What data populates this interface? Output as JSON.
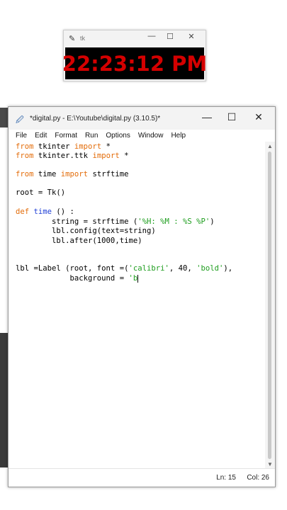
{
  "clock_window": {
    "title": "tk",
    "time": "22:23:12 PM",
    "controls": {
      "minimize": "—",
      "maximize": "☐",
      "close": "✕"
    }
  },
  "editor": {
    "title": "*digital.py - E:\\Youtube\\digital.py (3.10.5)*",
    "controls": {
      "minimize": "—",
      "maximize": "☐",
      "close": "✕"
    },
    "menu": [
      "File",
      "Edit",
      "Format",
      "Run",
      "Options",
      "Window",
      "Help"
    ],
    "code": {
      "l1": {
        "k1": "from",
        "t1": " tkinter ",
        "k2": "import",
        "t2": " *"
      },
      "l2": {
        "k1": "from",
        "t1": " tkinter.ttk ",
        "k2": "import",
        "t2": " *"
      },
      "l3": {
        "k1": "from",
        "t1": " time ",
        "k2": "import",
        "t2": " strftime"
      },
      "l4": {
        "t1": "root = Tk()"
      },
      "l5": {
        "k1": "def",
        "sp": " ",
        "f1": "time",
        "t1": " () :"
      },
      "l6": {
        "t1": "        string = strftime (",
        "s1": "'%H: %M : %S %P'",
        "t2": ")"
      },
      "l7": {
        "t1": "        lbl.config(text=string)"
      },
      "l8": {
        "t1": "        lbl.after(1000,time)"
      },
      "l9": {
        "t1": "lbl =Label (root, font =(",
        "s1": "'calibri'",
        "t2": ", 40, ",
        "s2": "'bold'",
        "t3": "),"
      },
      "l10": {
        "t1": "            background = ",
        "s1": "'b"
      }
    },
    "status": {
      "line": "Ln: 15",
      "col": "Col: 26"
    }
  }
}
